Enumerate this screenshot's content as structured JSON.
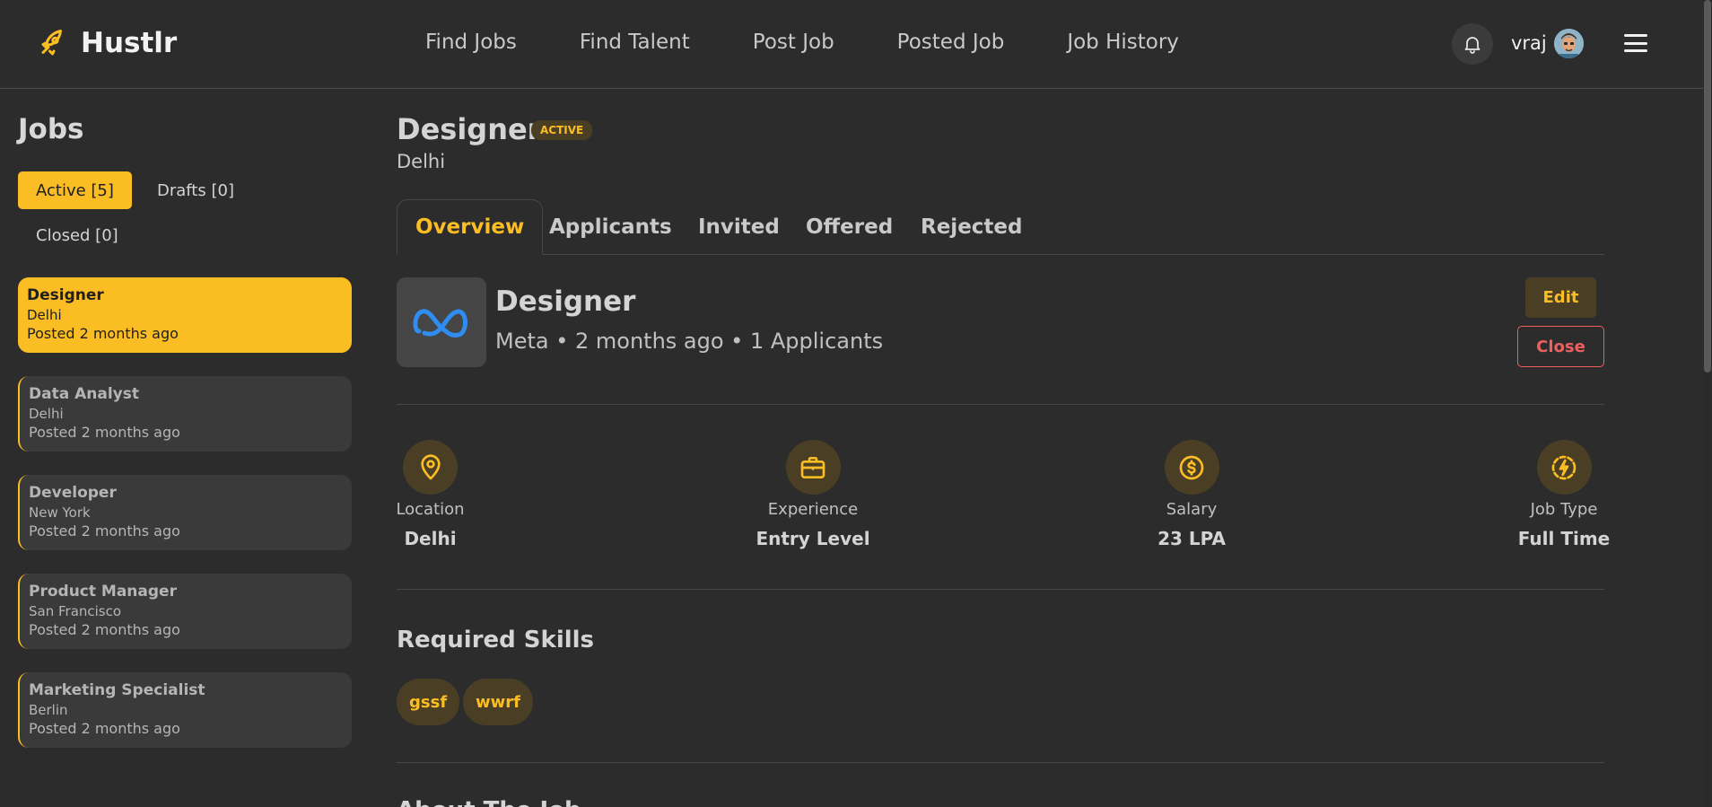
{
  "brand": {
    "name": "Hustlr"
  },
  "nav": {
    "items": [
      "Find Jobs",
      "Find Talent",
      "Post Job",
      "Posted Job",
      "Job History"
    ]
  },
  "user": {
    "name": "vraj"
  },
  "sidebar": {
    "title": "Jobs",
    "filters": [
      "Active [5]",
      "Drafts [0]",
      "Closed [0]"
    ],
    "jobs": [
      {
        "title": "Designer",
        "location": "Delhi",
        "posted": "Posted 2 months ago"
      },
      {
        "title": "Data Analyst",
        "location": "Delhi",
        "posted": "Posted 2 months ago"
      },
      {
        "title": "Developer",
        "location": "New York",
        "posted": "Posted 2 months ago"
      },
      {
        "title": "Product Manager",
        "location": "San Francisco",
        "posted": "Posted 2 months ago"
      },
      {
        "title": "Marketing Specialist",
        "location": "Berlin",
        "posted": "Posted 2 months ago"
      }
    ]
  },
  "job": {
    "title": "Designer",
    "status": "ACTIVE",
    "location": "Delhi",
    "tabs": [
      "Overview",
      "Applicants",
      "Invited",
      "Offered",
      "Rejected"
    ],
    "detail_title": "Designer",
    "meta": "Meta • 2 months ago • 1 Applicants",
    "edit_label": "Edit",
    "close_label": "Close",
    "stats": [
      {
        "label": "Location",
        "value": "Delhi"
      },
      {
        "label": "Experience",
        "value": "Entry Level"
      },
      {
        "label": "Salary",
        "value": "23 LPA"
      },
      {
        "label": "Job Type",
        "value": "Full Time"
      }
    ],
    "skills_title": "Required Skills",
    "skills": [
      "gssf",
      "wwrf"
    ],
    "about_title": "About The Job"
  },
  "colors": {
    "accent": "#fbbd24",
    "background": "#2c2c2c",
    "danger": "#ef5f5f"
  }
}
